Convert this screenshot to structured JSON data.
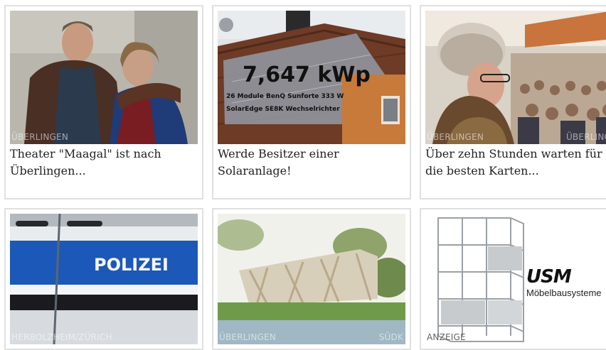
{
  "cards": [
    {
      "overline": "ÜBERLINGEN",
      "title": "Theater \"Maagal\" ist nach Überlingen..."
    },
    {
      "overline": "",
      "title": "Werde Besitzer einer Solaranlage!",
      "image_text": {
        "kwp": "7,647 kWp",
        "line1": "26 Module BenQ Sunforte 333 W",
        "line2": "SolarEdge SE8K Wechselrichter"
      }
    },
    {
      "overline": "ÜBERLINGEN",
      "overline_right": "ÜBERLING",
      "title": "Über zehn Stunden warten für die besten Karten..."
    },
    {
      "overline": "HERBOLZHEIM/ZÜRICH",
      "image_text": {
        "police": "POLIZEI"
      }
    },
    {
      "overline": "ÜBERLINGEN",
      "overline_right": "SÜDK"
    },
    {
      "overline": "ANZEIGE",
      "ad": {
        "brand": "USM",
        "tagline": "Möbelbausysteme"
      }
    }
  ]
}
